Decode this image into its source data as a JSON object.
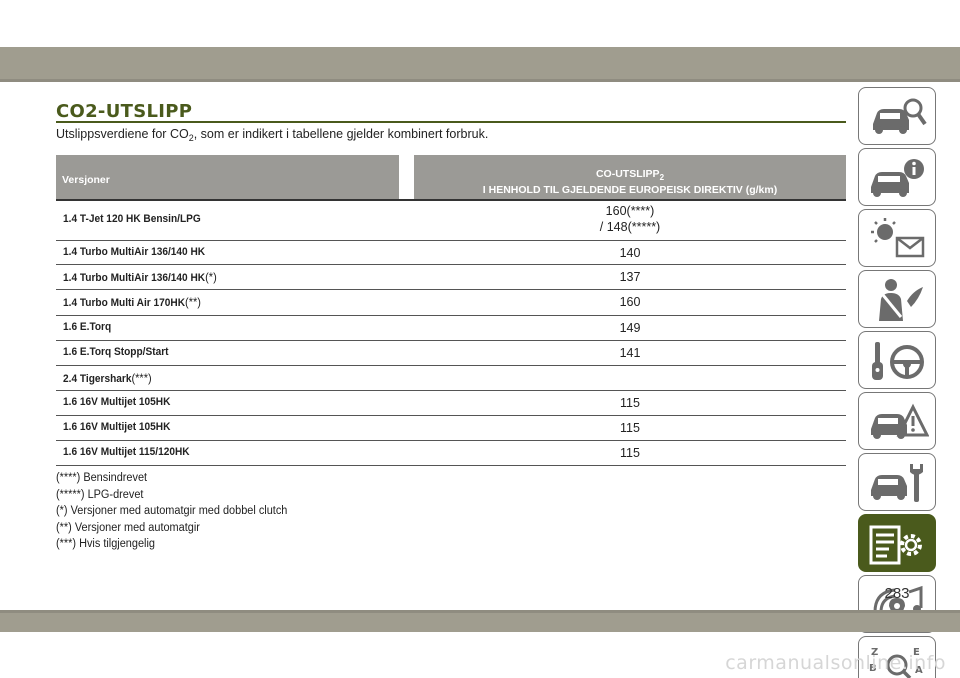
{
  "title": "CO2-UTSLIPP",
  "intro": {
    "before": "Utslippsverdiene for CO",
    "sub": "2",
    "after": ", som er indikert i tabellene gjelder kombinert forbruk."
  },
  "table": {
    "col1": "Versjoner",
    "col2_line1": "CO-UTSLIPP",
    "col2_sub": "2",
    "col2_line2": "I HENHOLD TIL GJELDENDE EUROPEISK DIREKTIV (g/km)",
    "rows": [
      {
        "version": "1.4 T-Jet 120 HK Bensin/LPG",
        "mark": "",
        "value": "160(****)",
        "value2": "/ 148(*****)"
      },
      {
        "version": "1.4 Turbo MultiAir 136/140 HK",
        "mark": "",
        "value": "140",
        "value2": ""
      },
      {
        "version": "1.4 Turbo MultiAir 136/140 HK",
        "mark": "(*)",
        "value": "137",
        "value2": ""
      },
      {
        "version": "1.4 Turbo Multi Air 170HK",
        "mark": "(**)",
        "value": "160",
        "value2": ""
      },
      {
        "version": "1.6 E.Torq",
        "mark": "",
        "value": "149",
        "value2": ""
      },
      {
        "version": "1.6 E.Torq Stopp/Start",
        "mark": "",
        "value": "141",
        "value2": ""
      },
      {
        "version": "2.4 Tigershark",
        "mark": "(***)",
        "value": "",
        "value2": ""
      },
      {
        "version": "1.6 16V Multijet 105HK",
        "mark": "",
        "value": "115",
        "value2": ""
      },
      {
        "version": "1.6 16V Multijet 105HK",
        "mark": "",
        "value": "115",
        "value2": ""
      },
      {
        "version": "1.6 16V Multijet 115/120HK",
        "mark": "",
        "value": "115",
        "value2": ""
      }
    ]
  },
  "notes": [
    "(****) Bensindrevet",
    "(*****) LPG-drevet",
    "(*) Versjoner med automatgir med dobbel clutch",
    "(**) Versjoner med automatgir",
    "(***) Hvis tilgjengelig"
  ],
  "sidebar": {
    "tabs": [
      {
        "icon": "car-search-icon",
        "active": false
      },
      {
        "icon": "car-info-icon",
        "active": false
      },
      {
        "icon": "warning-light-message-icon",
        "active": false
      },
      {
        "icon": "seatbelt-person-icon",
        "active": false
      },
      {
        "icon": "key-steering-wheel-icon",
        "active": false
      },
      {
        "icon": "car-breakdown-icon",
        "active": false
      },
      {
        "icon": "car-wrench-icon",
        "active": false
      },
      {
        "icon": "list-gear-icon",
        "active": true
      },
      {
        "icon": "media-music-icon",
        "active": false
      },
      {
        "icon": "alphabet-index-icon",
        "active": false
      }
    ]
  },
  "page_number": "283",
  "watermark": "carmanualsonline.info",
  "colors": {
    "accent": "#4a5a1c",
    "band": "#a09d8f",
    "table_header": "#9b9a96"
  }
}
